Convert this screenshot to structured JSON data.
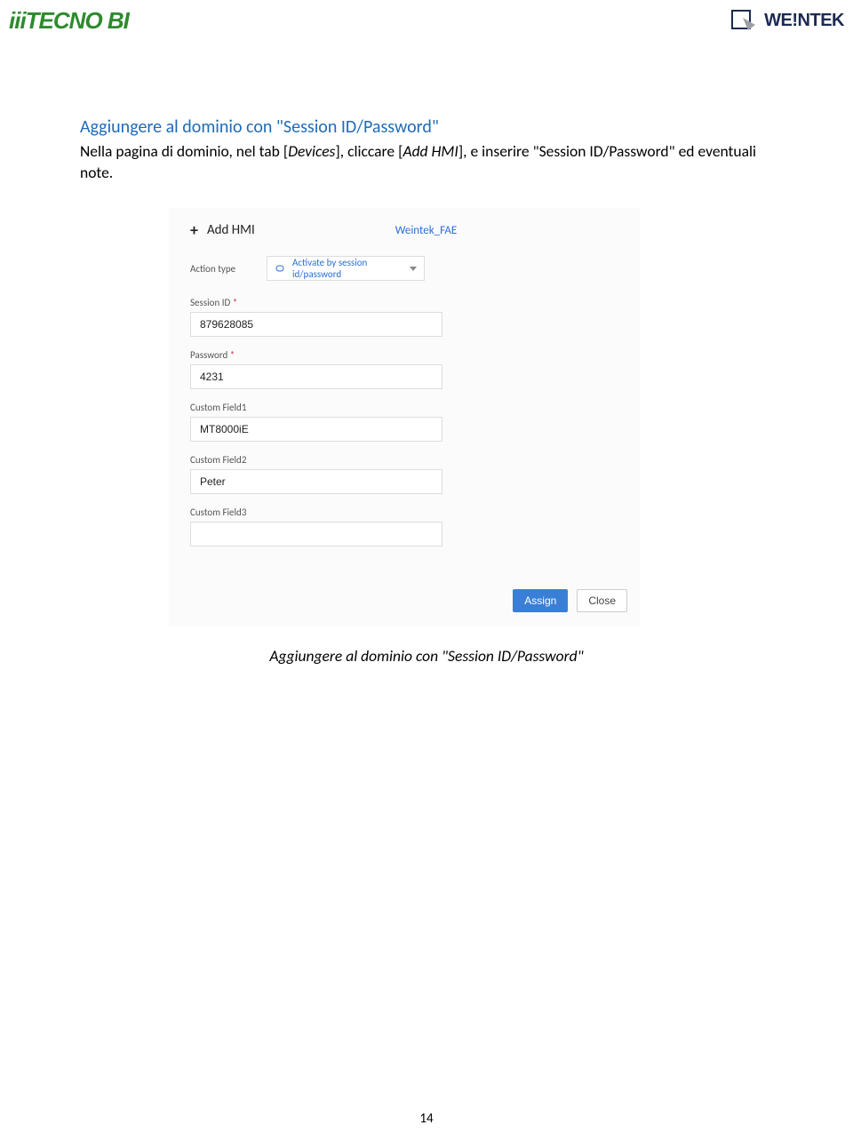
{
  "header": {
    "logo_left": "iiiTECNO BI",
    "logo_right": "WE!NTEK"
  },
  "section": {
    "heading": "Aggiungere al dominio con \"Session ID/Password\"",
    "body_1": "Nella pagina di dominio, nel tab [",
    "body_ital_1": "Devices",
    "body_2": "], cliccare [",
    "body_ital_2": "Add HMI",
    "body_3": "], e inserire \"Session ID/Password\" ed eventuali note."
  },
  "screenshot": {
    "add_hmi_title": "Add HMI",
    "domain_name": "Weintek_FAE",
    "action_type_label": "Action type",
    "action_type_value": "Activate by session id/password",
    "fields": {
      "session_id_label": "Session ID",
      "session_id_value": "879628085",
      "password_label": "Password",
      "password_value": "4231",
      "custom1_label": "Custom Field1",
      "custom1_value": "MT8000iE",
      "custom2_label": "Custom Field2",
      "custom2_value": "Peter",
      "custom3_label": "Custom Field3",
      "custom3_value": ""
    },
    "required_mark": "*",
    "assign_label": "Assign",
    "close_label": "Close"
  },
  "caption": "Aggiungere al dominio con \"Session ID/Password\"",
  "page_number": "14"
}
